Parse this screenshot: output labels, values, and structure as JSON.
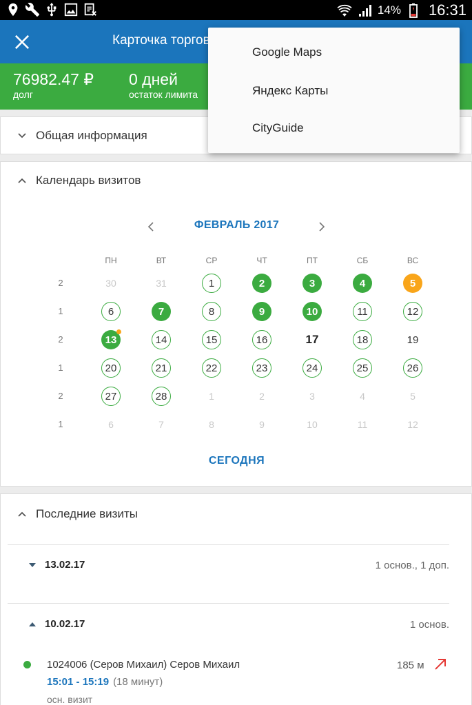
{
  "status_bar": {
    "battery_percent": "14%",
    "time": "16:31"
  },
  "app_bar": {
    "title": "Карточка торговой точки"
  },
  "summary": {
    "debt_value": "76982.47 ₽",
    "debt_label": "долг",
    "days_value": "0 дней",
    "days_label": "остаток лимита"
  },
  "general_info": {
    "title": "Общая информация"
  },
  "calendar": {
    "title": "Календарь визитов",
    "month": "ФЕВРАЛЬ 2017",
    "weekdays": [
      "ПН",
      "ВТ",
      "СР",
      "ЧТ",
      "ПТ",
      "СБ",
      "ВС"
    ],
    "weeks": [
      {
        "count": "2",
        "days": [
          {
            "n": "30",
            "s": "muted"
          },
          {
            "n": "31",
            "s": "muted"
          },
          {
            "n": "1",
            "s": "outline"
          },
          {
            "n": "2",
            "s": "green"
          },
          {
            "n": "3",
            "s": "green"
          },
          {
            "n": "4",
            "s": "green"
          },
          {
            "n": "5",
            "s": "orange"
          }
        ]
      },
      {
        "count": "1",
        "days": [
          {
            "n": "6",
            "s": "outline"
          },
          {
            "n": "7",
            "s": "green"
          },
          {
            "n": "8",
            "s": "outline"
          },
          {
            "n": "9",
            "s": "green"
          },
          {
            "n": "10",
            "s": "green"
          },
          {
            "n": "11",
            "s": "outline"
          },
          {
            "n": "12",
            "s": "outline"
          }
        ]
      },
      {
        "count": "2",
        "days": [
          {
            "n": "13",
            "s": "green-dot"
          },
          {
            "n": "14",
            "s": "outline"
          },
          {
            "n": "15",
            "s": "outline"
          },
          {
            "n": "16",
            "s": "outline"
          },
          {
            "n": "17",
            "s": "today"
          },
          {
            "n": "18",
            "s": "outline"
          },
          {
            "n": "19",
            "s": "plain"
          }
        ]
      },
      {
        "count": "1",
        "days": [
          {
            "n": "20",
            "s": "outline"
          },
          {
            "n": "21",
            "s": "outline"
          },
          {
            "n": "22",
            "s": "outline"
          },
          {
            "n": "23",
            "s": "outline"
          },
          {
            "n": "24",
            "s": "outline"
          },
          {
            "n": "25",
            "s": "outline"
          },
          {
            "n": "26",
            "s": "outline"
          }
        ]
      },
      {
        "count": "2",
        "days": [
          {
            "n": "27",
            "s": "outline"
          },
          {
            "n": "28",
            "s": "outline"
          },
          {
            "n": "1",
            "s": "muted"
          },
          {
            "n": "2",
            "s": "muted"
          },
          {
            "n": "3",
            "s": "muted"
          },
          {
            "n": "4",
            "s": "muted"
          },
          {
            "n": "5",
            "s": "muted"
          }
        ]
      },
      {
        "count": "1",
        "days": [
          {
            "n": "6",
            "s": "muted"
          },
          {
            "n": "7",
            "s": "muted"
          },
          {
            "n": "8",
            "s": "muted"
          },
          {
            "n": "9",
            "s": "muted"
          },
          {
            "n": "10",
            "s": "muted"
          },
          {
            "n": "11",
            "s": "muted"
          },
          {
            "n": "12",
            "s": "muted"
          }
        ]
      }
    ],
    "today_label": "СЕГОДНЯ"
  },
  "recent_visits": {
    "title": "Последние визиты",
    "groups": [
      {
        "date": "13.02.17",
        "summary": "1 основ., 1 доп.",
        "expanded": false
      },
      {
        "date": "10.02.17",
        "summary": "1 основ.",
        "expanded": true
      }
    ],
    "visit": {
      "name": "1024006 (Серов Михаил) Серов Михаил",
      "time": "15:01 - 15:19",
      "duration": "(18 минут)",
      "type": "осн. визит",
      "distance": "185  м"
    }
  },
  "popup_menu": {
    "items": [
      "Google Maps",
      "Яндекс Карты",
      "CityGuide"
    ]
  },
  "colors": {
    "primary": "#1b75bc",
    "green": "#3bab40",
    "orange": "#f9a51a",
    "arrow_red": "#e53935"
  }
}
